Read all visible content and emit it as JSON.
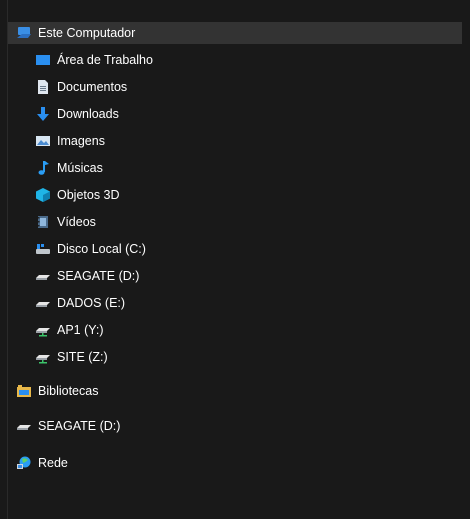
{
  "nav_pane": {
    "this_pc": {
      "label": "Este Computador",
      "icon": "computer-icon"
    },
    "folders": [
      {
        "label": "Área de Trabalho",
        "icon": "desktop-icon"
      },
      {
        "label": "Documentos",
        "icon": "documents-icon"
      },
      {
        "label": "Downloads",
        "icon": "downloads-icon"
      },
      {
        "label": "Imagens",
        "icon": "pictures-icon"
      },
      {
        "label": "Músicas",
        "icon": "music-icon"
      },
      {
        "label": "Objetos 3D",
        "icon": "3d-objects-icon"
      },
      {
        "label": "Vídeos",
        "icon": "videos-icon"
      }
    ],
    "drives": [
      {
        "label": "Disco Local (C:)",
        "icon": "windows-drive-icon"
      },
      {
        "label": "SEAGATE (D:)",
        "icon": "drive-icon"
      },
      {
        "label": "DADOS (E:)",
        "icon": "drive-icon"
      },
      {
        "label": "AP1 (Y:)",
        "icon": "network-drive-icon"
      },
      {
        "label": "SITE  (Z:)",
        "icon": "network-drive-icon"
      }
    ],
    "libraries": {
      "label": "Bibliotecas",
      "icon": "libraries-icon"
    },
    "removable": {
      "label": "SEAGATE (D:)",
      "icon": "drive-icon"
    },
    "network": {
      "label": "Rede",
      "icon": "network-icon"
    }
  },
  "colors": {
    "background": "#191919",
    "selected": "#333333",
    "text": "#ffffff",
    "accent_blue": "#1e90ff"
  }
}
